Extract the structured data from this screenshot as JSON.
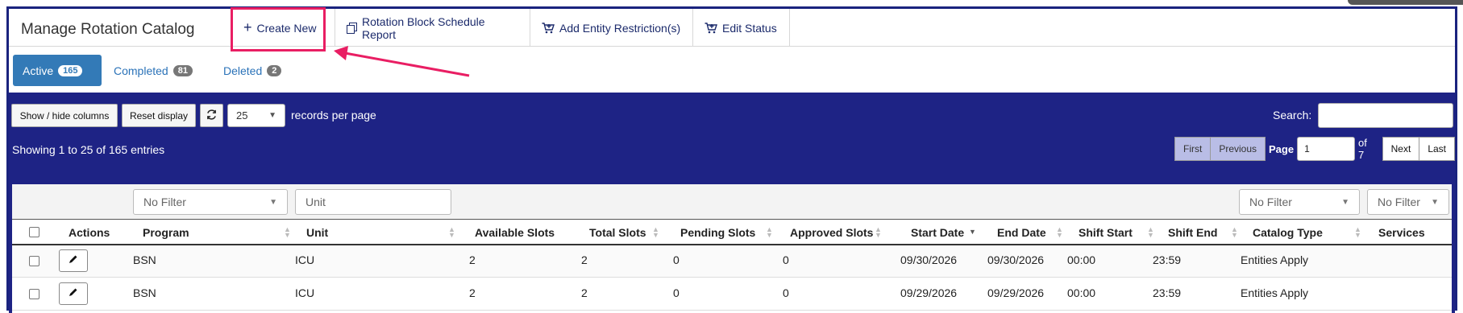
{
  "header": {
    "title": "Manage Rotation Catalog",
    "actions": [
      {
        "label": "Create New",
        "icon": "plus-icon"
      },
      {
        "label": "Rotation Block Schedule Report",
        "icon": "copy-icon"
      },
      {
        "label": "Add Entity Restriction(s)",
        "icon": "cart-add-icon"
      },
      {
        "label": "Edit Status",
        "icon": "cart-add-icon"
      }
    ]
  },
  "tabs": [
    {
      "label": "Active",
      "count": "165"
    },
    {
      "label": "Completed",
      "count": "81"
    },
    {
      "label": "Deleted",
      "count": "2"
    }
  ],
  "toolbar": {
    "show_hide_label": "Show / hide columns",
    "reset_label": "Reset display",
    "page_size": "25",
    "records_label": "records per page",
    "search_label": "Search:",
    "search_value": ""
  },
  "info": "Showing 1 to 25 of 165 entries",
  "pager": {
    "first": "First",
    "previous": "Previous",
    "page_label": "Page",
    "page_value": "1",
    "of_label": "of 7",
    "next": "Next",
    "last": "Last"
  },
  "filters": {
    "program": "No Filter",
    "unit_placeholder": "Unit",
    "catalog_type": "No Filter",
    "services": "No Filter"
  },
  "columns": [
    "Actions",
    "Program",
    "Unit",
    "Available Slots",
    "Total Slots",
    "Pending Slots",
    "Approved Slots",
    "Start Date",
    "End Date",
    "Shift Start",
    "Shift End",
    "Catalog Type",
    "Services"
  ],
  "rows": [
    {
      "program": "BSN",
      "unit": "ICU",
      "available": "2",
      "total": "2",
      "pending": "0",
      "approved": "0",
      "start": "09/30/2026",
      "end": "09/30/2026",
      "shift_start": "00:00",
      "shift_end": "23:59",
      "catalog_type": "Entities Apply",
      "services": ""
    },
    {
      "program": "BSN",
      "unit": "ICU",
      "available": "2",
      "total": "2",
      "pending": "0",
      "approved": "0",
      "start": "09/29/2026",
      "end": "09/29/2026",
      "shift_start": "00:00",
      "shift_end": "23:59",
      "catalog_type": "Entities Apply",
      "services": ""
    }
  ],
  "colors": {
    "panel": "#1e2385",
    "accent": "#337ab7",
    "highlight": "#e91e63"
  }
}
